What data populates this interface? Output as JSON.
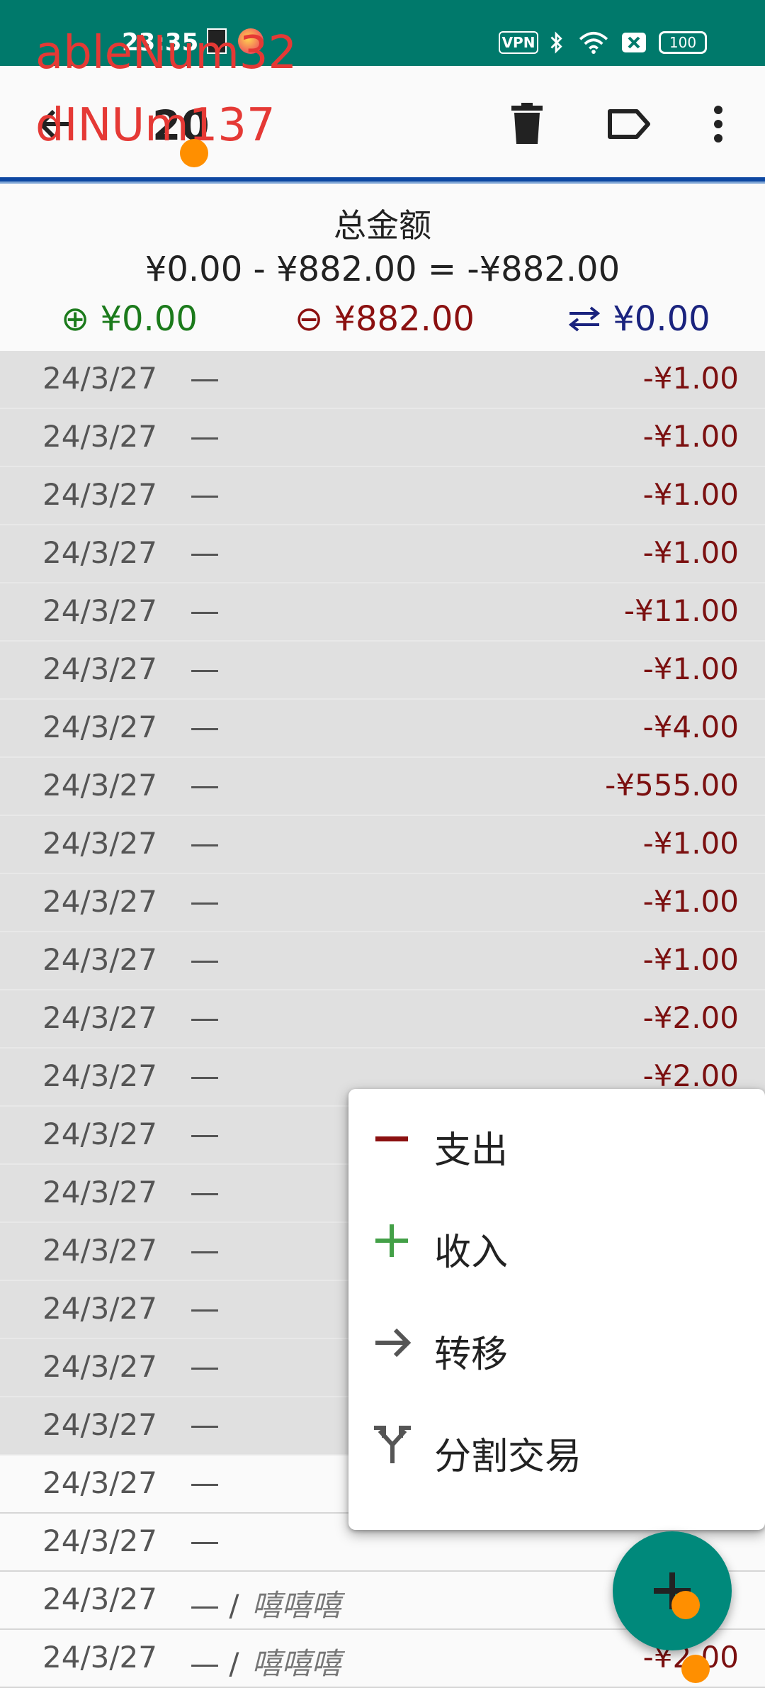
{
  "status_bar": {
    "time": "23:35",
    "vpn_label": "VPN",
    "battery": "100",
    "icons": [
      "proxy-app-icon",
      "bluetooth-icon",
      "wifi-icon",
      "sim-off-icon"
    ]
  },
  "toolbar": {
    "title": "20",
    "icons": [
      "back-arrow-icon",
      "delete-icon",
      "label-icon",
      "more-vert-icon"
    ]
  },
  "overlay": {
    "line1": "ableNum32",
    "line2": "dINUm137"
  },
  "summary": {
    "label": "总金额",
    "equation": "¥0.00 - ¥882.00 = -¥882.00",
    "income": "⊕ ¥0.00",
    "expense": "⊖ ¥882.00",
    "transfer": "¥0.00",
    "colors": {
      "income": "#1b7a1b",
      "expense": "#8b1010",
      "transfer": "#1a237e"
    }
  },
  "transactions": [
    {
      "date": "24/3/27",
      "desc": "—",
      "memo": "",
      "amount": "-¥1.00"
    },
    {
      "date": "24/3/27",
      "desc": "—",
      "memo": "",
      "amount": "-¥1.00"
    },
    {
      "date": "24/3/27",
      "desc": "—",
      "memo": "",
      "amount": "-¥1.00"
    },
    {
      "date": "24/3/27",
      "desc": "—",
      "memo": "",
      "amount": "-¥1.00"
    },
    {
      "date": "24/3/27",
      "desc": "—",
      "memo": "",
      "amount": "-¥11.00"
    },
    {
      "date": "24/3/27",
      "desc": "—",
      "memo": "",
      "amount": "-¥1.00"
    },
    {
      "date": "24/3/27",
      "desc": "—",
      "memo": "",
      "amount": "-¥4.00"
    },
    {
      "date": "24/3/27",
      "desc": "—",
      "memo": "",
      "amount": "-¥555.00"
    },
    {
      "date": "24/3/27",
      "desc": "—",
      "memo": "",
      "amount": "-¥1.00"
    },
    {
      "date": "24/3/27",
      "desc": "—",
      "memo": "",
      "amount": "-¥1.00"
    },
    {
      "date": "24/3/27",
      "desc": "—",
      "memo": "",
      "amount": "-¥1.00"
    },
    {
      "date": "24/3/27",
      "desc": "—",
      "memo": "",
      "amount": "-¥2.00"
    },
    {
      "date": "24/3/27",
      "desc": "—",
      "memo": "",
      "amount": "-¥2.00"
    },
    {
      "date": "24/3/27",
      "desc": "—",
      "memo": "",
      "amount": ""
    },
    {
      "date": "24/3/27",
      "desc": "—",
      "memo": "",
      "amount": ""
    },
    {
      "date": "24/3/27",
      "desc": "—",
      "memo": "",
      "amount": ""
    },
    {
      "date": "24/3/27",
      "desc": "—",
      "memo": "",
      "amount": ""
    },
    {
      "date": "24/3/27",
      "desc": "—",
      "memo": "",
      "amount": ""
    },
    {
      "date": "24/3/27",
      "desc": "—",
      "memo": "",
      "amount": ""
    },
    {
      "date": "24/3/27",
      "desc": "—",
      "memo": "",
      "amount": ""
    },
    {
      "date": "24/3/27",
      "desc": "—",
      "memo": "",
      "amount": ""
    },
    {
      "date": "24/3/27",
      "desc": "— /",
      "memo": "嘻嘻嘻",
      "amount": ""
    },
    {
      "date": "24/3/27",
      "desc": "— /",
      "memo": "嘻嘻嘻",
      "amount": "-¥2.00"
    }
  ],
  "popup_menu": {
    "items": [
      {
        "label": "支出",
        "icon": "minus-icon",
        "color": "#8b1010"
      },
      {
        "label": "收入",
        "icon": "plus-icon",
        "color": "#43a047"
      },
      {
        "label": "转移",
        "icon": "arrow-right-icon",
        "color": "#555555"
      },
      {
        "label": "分割交易",
        "icon": "split-icon",
        "color": "#555555"
      }
    ]
  },
  "fab": {
    "icon": "add-icon"
  }
}
